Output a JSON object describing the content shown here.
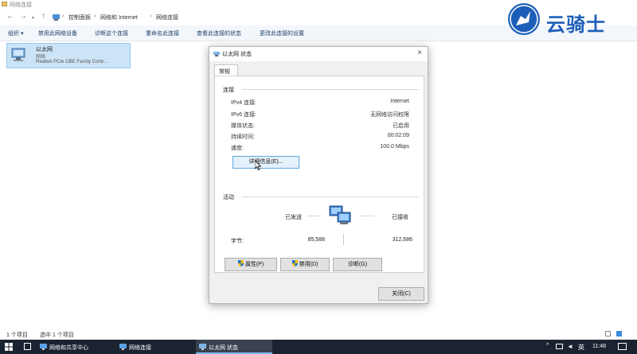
{
  "window": {
    "title": "网络连接"
  },
  "nav": {
    "back": "←",
    "forward": "→",
    "up": "↑"
  },
  "breadcrumb": [
    "控制面板",
    "网络和 Internet",
    "网络连接"
  ],
  "commands": [
    "组织",
    "禁用此网络设备",
    "诊断这个连接",
    "重命名此连接",
    "查看此连接的状态",
    "更改此连接的设置"
  ],
  "item": {
    "name": "以太网",
    "status": "网络",
    "adapter": "Realtek PCIe GBE Family Contr..."
  },
  "dialog": {
    "title": "以太网 状态",
    "close": "×",
    "tab": "常规",
    "connection": {
      "header": "连接",
      "rows": [
        {
          "label": "IPv4 连接:",
          "value": "Internet"
        },
        {
          "label": "IPv6 连接:",
          "value": "无网络访问权限"
        },
        {
          "label": "媒体状态:",
          "value": "已启用"
        },
        {
          "label": "持续时间:",
          "value": "00:02:09"
        },
        {
          "label": "速度:",
          "value": "100.0 Mbps"
        }
      ],
      "details_button": "详细信息(E)..."
    },
    "activity": {
      "header": "活动",
      "sent_label": "已发送",
      "received_label": "已接收",
      "bytes_label": "字节:",
      "bytes_sent": "85,588",
      "bytes_received": "312,686"
    },
    "buttons": {
      "properties": "属性(P)",
      "disable": "禁用(D)",
      "diagnose": "诊断(G)",
      "close": "关闭(C)"
    }
  },
  "statusbar": {
    "count": "1 个项目",
    "selected": "选中 1 个项目"
  },
  "taskbar": {
    "items": [
      "网络和共享中心",
      "网络连接",
      "以太网 状态"
    ],
    "ime": "英",
    "time": "11:48"
  },
  "watermark": {
    "text": "云骑士"
  },
  "colors": {
    "accent": "#0078d7",
    "taskbar": "#1b2230",
    "selection": "#cce4f7"
  }
}
